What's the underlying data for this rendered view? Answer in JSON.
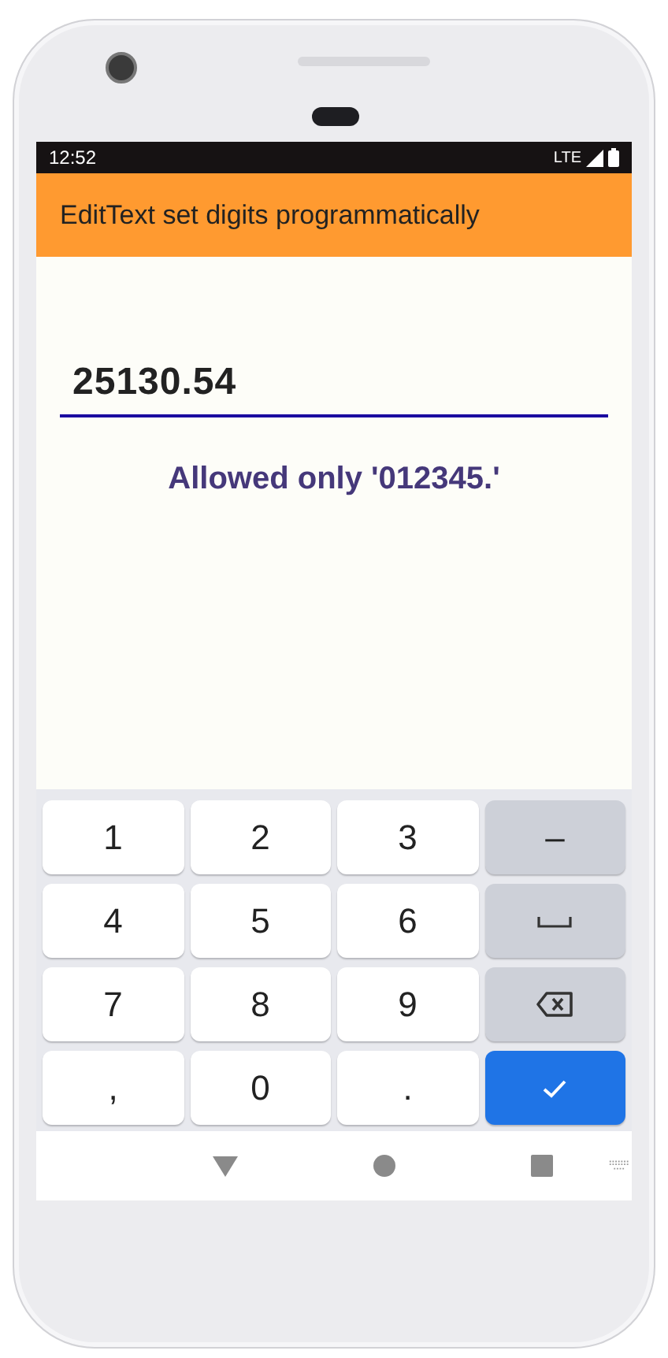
{
  "status_bar": {
    "time": "12:52",
    "network": "LTE"
  },
  "app_bar": {
    "title": "EditText set digits programmatically"
  },
  "field": {
    "value": "25130.54"
  },
  "message": "Allowed only '012345.'",
  "keyboard": {
    "keys": [
      {
        "kind": "char",
        "label": "1"
      },
      {
        "kind": "char",
        "label": "2"
      },
      {
        "kind": "char",
        "label": "3"
      },
      {
        "kind": "function",
        "label": "–"
      },
      {
        "kind": "char",
        "label": "4"
      },
      {
        "kind": "char",
        "label": "5"
      },
      {
        "kind": "char",
        "label": "6"
      },
      {
        "kind": "space"
      },
      {
        "kind": "char",
        "label": "7"
      },
      {
        "kind": "char",
        "label": "8"
      },
      {
        "kind": "char",
        "label": "9"
      },
      {
        "kind": "backspace"
      },
      {
        "kind": "char",
        "label": ","
      },
      {
        "kind": "char",
        "label": "0"
      },
      {
        "kind": "char",
        "label": "."
      },
      {
        "kind": "enter"
      }
    ]
  }
}
